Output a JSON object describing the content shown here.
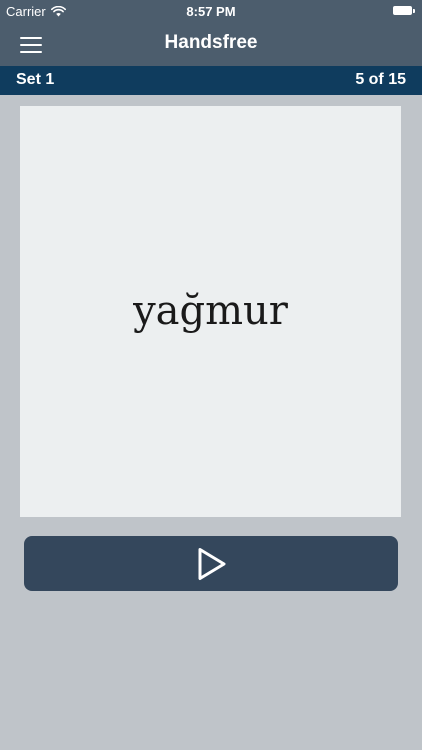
{
  "status_bar": {
    "carrier": "Carrier",
    "time": "8:57 PM",
    "icons": [
      "wifi-icon",
      "battery-icon"
    ]
  },
  "nav": {
    "title": "Handsfree",
    "menu_icon": "hamburger-menu-icon"
  },
  "set_bar": {
    "name": "Set 1",
    "progress": "5 of 15"
  },
  "card": {
    "word": "yağmur"
  },
  "play_button": {
    "icon": "play-icon"
  },
  "colors": {
    "nav_background": "#4c5d6d",
    "set_bar_background": "#0f3c5e",
    "card_background": "#eceff0",
    "page_background": "#bfc4c9",
    "play_button_background": "#34475c"
  }
}
